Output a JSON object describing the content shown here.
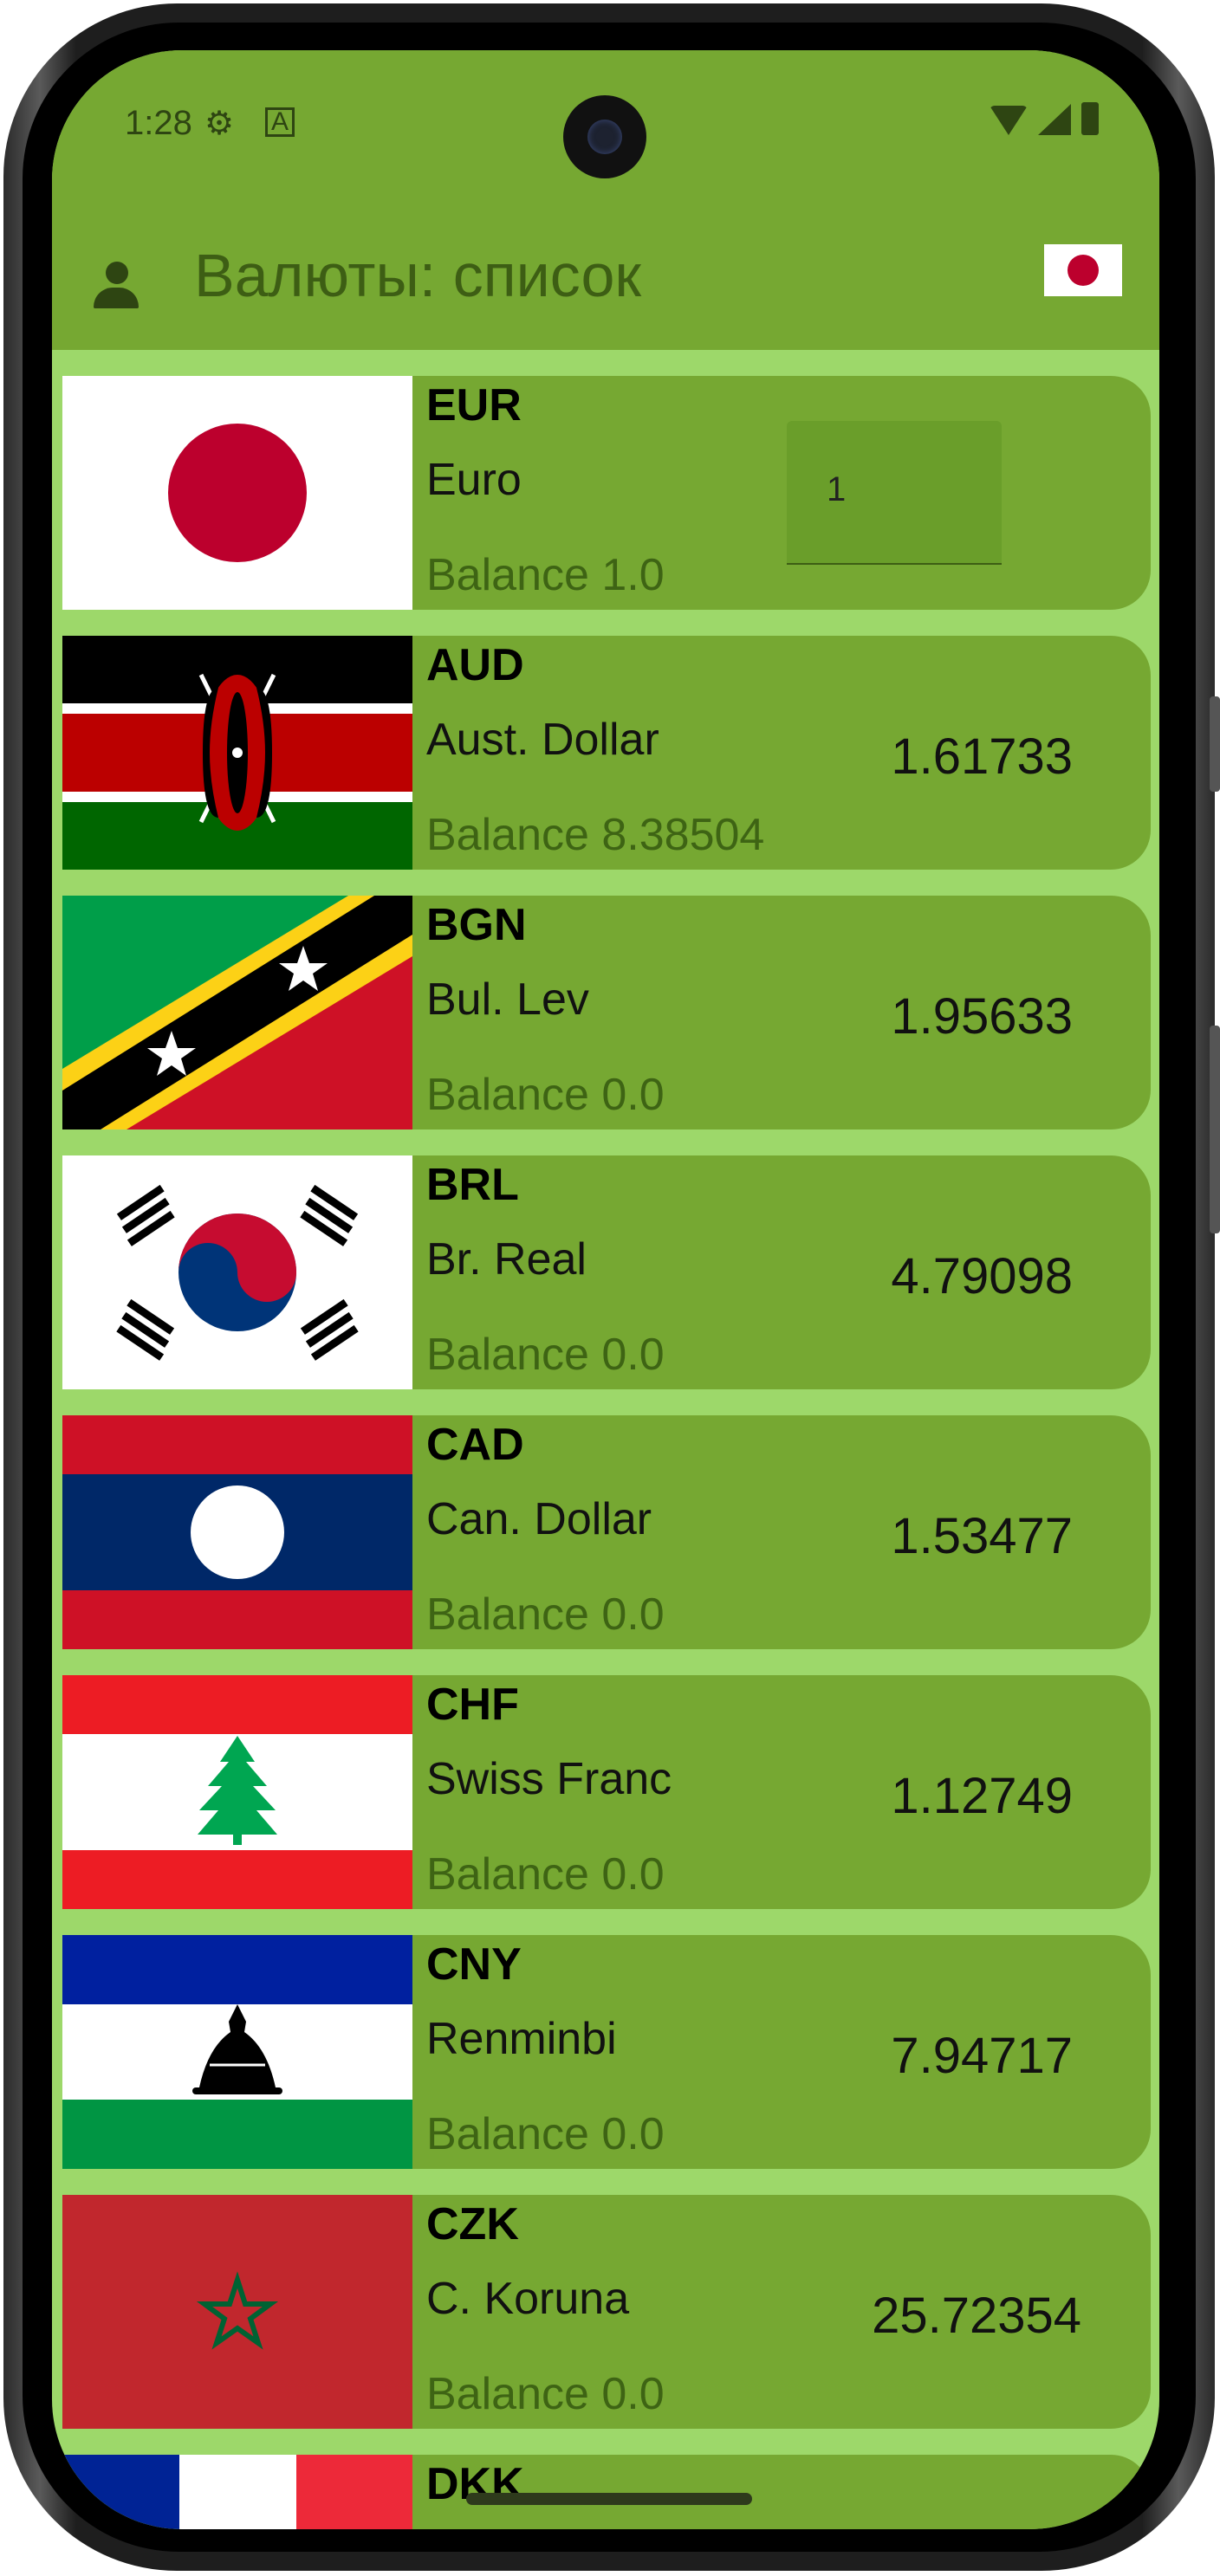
{
  "status": {
    "time": "1:28"
  },
  "app": {
    "title": "Валюты: список"
  },
  "rows": [
    {
      "code": "EUR",
      "name": "Euro",
      "balance": "Balance 1.0",
      "input_value": "1"
    },
    {
      "code": "AUD",
      "name": "Aust. Dollar",
      "balance": "Balance 8.38504",
      "rate": "1.61733"
    },
    {
      "code": "BGN",
      "name": "Bul. Lev",
      "balance": "Balance 0.0",
      "rate": "1.95633"
    },
    {
      "code": "BRL",
      "name": "Br. Real",
      "balance": "Balance 0.0",
      "rate": "4.79098"
    },
    {
      "code": "CAD",
      "name": "Can. Dollar",
      "balance": "Balance 0.0",
      "rate": "1.53477"
    },
    {
      "code": "CHF",
      "name": "Swiss Franc",
      "balance": "Balance 0.0",
      "rate": "1.12749"
    },
    {
      "code": "CNY",
      "name": "Renminbi",
      "balance": "Balance 0.0",
      "rate": "7.94717"
    },
    {
      "code": "CZK",
      "name": "C. Koruna",
      "balance": "Balance 0.0",
      "rate": "25.72354"
    },
    {
      "code": "DKK"
    }
  ],
  "colors": {
    "app_bar": "#76a832",
    "list_bg": "#9dd86a",
    "card": "#76a832",
    "title": "#3d5e14"
  }
}
